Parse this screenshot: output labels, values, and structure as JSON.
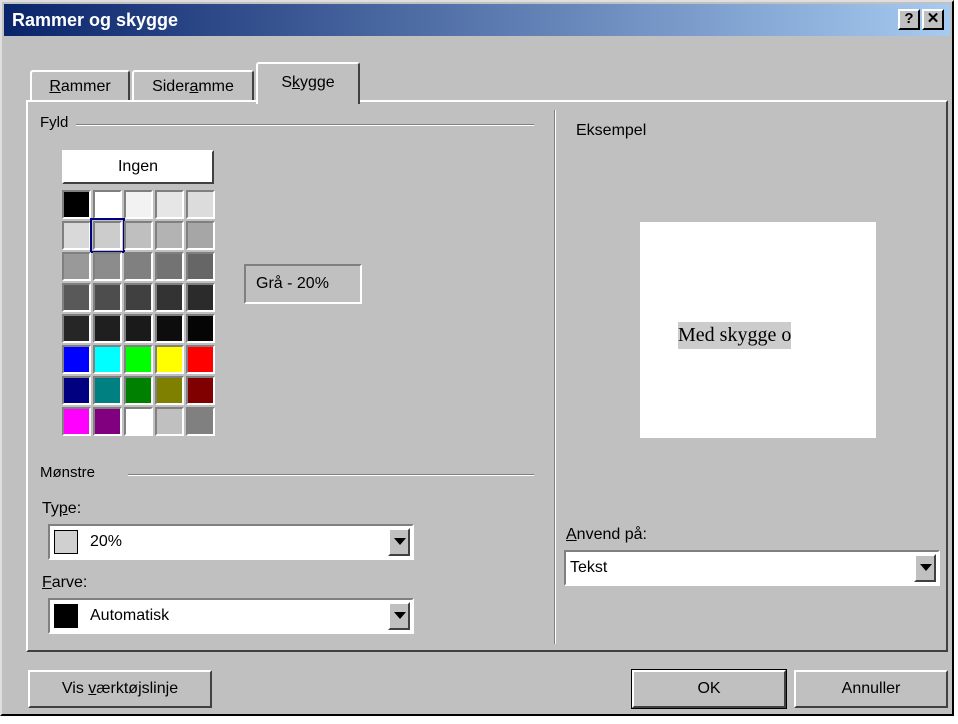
{
  "window": {
    "title": "Rammer og skygge",
    "help_button": "?",
    "close_button": "✕"
  },
  "tabs": [
    {
      "label_pre": "",
      "label_u": "R",
      "label_post": "ammer"
    },
    {
      "label_pre": "Sider",
      "label_u": "a",
      "label_post": "mme"
    },
    {
      "label_pre": "S",
      "label_u": "k",
      "label_post": "ygge"
    }
  ],
  "fill": {
    "group_label": "Fyld",
    "none_button": "Ingen",
    "selected_color_name": "Grå - 20%",
    "palette_rows": [
      [
        "#000000",
        "#ffffff",
        "#f2f2f2",
        "#e6e6e6",
        "#dcdcdc"
      ],
      [
        "#d9d9d9",
        "#cccccc",
        "#bfbfbf",
        "#b3b3b3",
        "#a6a6a6"
      ],
      [
        "#999999",
        "#8c8c8c",
        "#808080",
        "#737373",
        "#666666"
      ],
      [
        "#595959",
        "#4d4d4d",
        "#404040",
        "#333333",
        "#2b2b2b"
      ],
      [
        "#262626",
        "#1f1f1f",
        "#1a1a1a",
        "#0d0d0d",
        "#050505"
      ],
      [
        "#0000ff",
        "#00ffff",
        "#00ff00",
        "#ffff00",
        "#ff0000"
      ],
      [
        "#000080",
        "#008080",
        "#008000",
        "#808000",
        "#800000"
      ],
      [
        "#ff00ff",
        "#800080",
        "#ffffff",
        "#c0c0c0",
        "#808080"
      ]
    ]
  },
  "patterns": {
    "group_label": "Mønstre",
    "type_label_pre": "Ty",
    "type_label_u": "p",
    "type_label_post": "e:",
    "type_value": "20%",
    "type_swatch_color": "#d0d0d0",
    "color_label_pre": "",
    "color_label_u": "F",
    "color_label_post": "arve:",
    "color_value": "Automatisk",
    "color_swatch_color": "#000000"
  },
  "preview": {
    "label": "Eksempel",
    "sample_text": "Med skygge o",
    "shade_color": "#cccccc"
  },
  "apply_to": {
    "label_pre": "",
    "label_u": "A",
    "label_post": "nvend på:",
    "value": "Tekst"
  },
  "buttons": {
    "toolbar_pre": "Vis ",
    "toolbar_u": "v",
    "toolbar_post": "ærktøjslinje",
    "ok": "OK",
    "cancel": "Annuller"
  }
}
